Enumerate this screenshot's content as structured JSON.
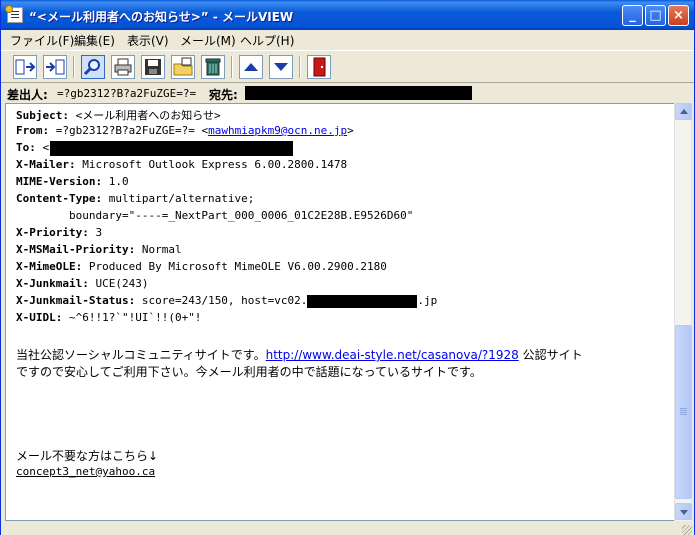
{
  "window": {
    "title": "“<メール利用者へのお知らせ>” - メールVIEW",
    "minimize_label": "_",
    "maximize_label": "□",
    "close_label": "×"
  },
  "menu": [
    "ファイル(F)",
    "編集(E)",
    "表示(V)",
    "メール(M)",
    "ヘルプ(H)"
  ],
  "toolbar": {
    "icons": [
      "import-icon",
      "export-icon",
      "find-icon",
      "print-icon",
      "save-icon",
      "copy-folder-icon",
      "trash-icon",
      "up-arrow-icon",
      "down-arrow-icon",
      "exit-door-icon"
    ]
  },
  "info": {
    "from_label": "差出人:",
    "from_value": "=?gb2312?B?a2FuZGE=?=",
    "to_label": "宛先:"
  },
  "headers": [
    {
      "name": "Subject:",
      "value": " <メール利用者へのお知らせ>"
    },
    {
      "name": "From:",
      "value": " =?gb2312?B?a2FuZGE=?= <",
      "link": "mawhmiapkm9@ocn.ne.jp",
      "suffix": ">"
    },
    {
      "name": "To:",
      "value": " <"
    },
    {
      "name": "X-Mailer:",
      "value": " Microsoft Outlook Express 6.00.2800.1478"
    },
    {
      "name": "MIME-Version:",
      "value": " 1.0"
    },
    {
      "name": "Content-Type:",
      "value": " multipart/alternative;"
    },
    {
      "name": "",
      "value": "        boundary=\"----=_NextPart_000_0006_01C2E28B.E9526D60\""
    },
    {
      "name": "X-Priority:",
      "value": " 3"
    },
    {
      "name": "X-MSMail-Priority:",
      "value": " Normal"
    },
    {
      "name": "X-MimeOLE:",
      "value": " Produced By Microsoft MimeOLE V6.00.2900.2180"
    },
    {
      "name": "X-Junkmail:",
      "value": " UCE(243)"
    },
    {
      "name": "X-Junkmail-Status:",
      "value": " score=243/150, host=vc02.",
      "suffix": ".jp"
    },
    {
      "name": "X-UIDL:",
      "value": " ~^6!!1?`\"!UI`!!(0+\"!"
    }
  ],
  "body": {
    "line1_pre": "当社公認ソーシャルコミュニティサイトです。",
    "line1_link": "http://www.deai-style.net/casanova/?1928",
    "line1_post": " 公認サイト",
    "line2": "ですので安心してご利用下さい。今メール利用者の中で話題になっているサイトです。",
    "unsubscribe": "メール不要な方はこちら↓",
    "unsubscribe_link": "concept3_net@yahoo.ca"
  }
}
